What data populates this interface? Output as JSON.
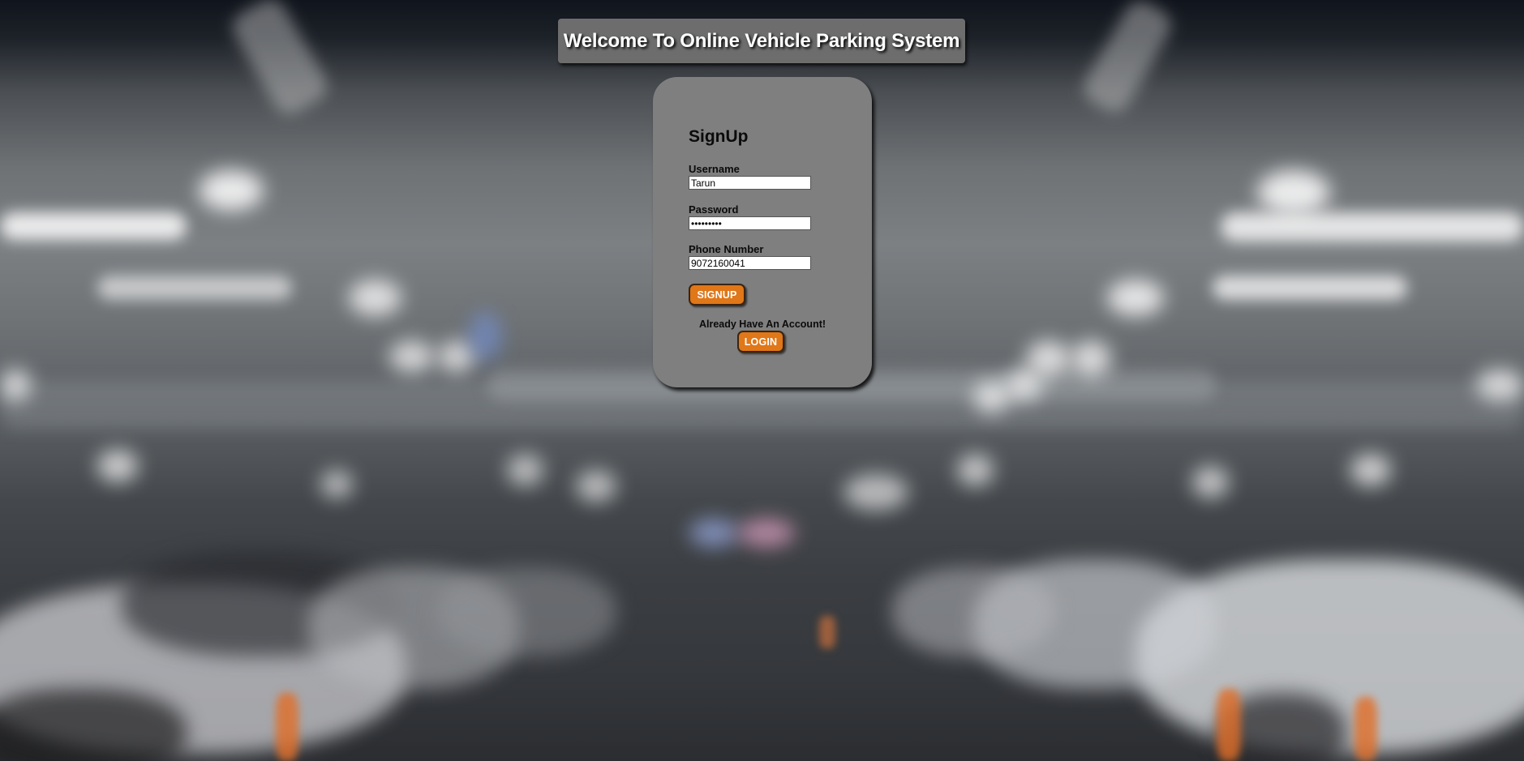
{
  "page": {
    "banner_title": "Welcome To Online Vehicle Parking System",
    "background_image": "blurred parking garage with white cars"
  },
  "signup_form": {
    "heading": "SignUp",
    "username": {
      "label": "Username",
      "value": "Tarun"
    },
    "password": {
      "label": "Password",
      "value": "•••••••••"
    },
    "phone": {
      "label": "Phone Number",
      "value": "9072160041"
    },
    "signup_button": "SIGNUP",
    "account_prompt": "Already Have An Account!",
    "login_button": "LOGIN"
  },
  "colors": {
    "banner_bg": "#6d6d6d",
    "card_bg": "#7f7f7f",
    "button_accent": "#e07718",
    "title_text": "#ffffff"
  }
}
